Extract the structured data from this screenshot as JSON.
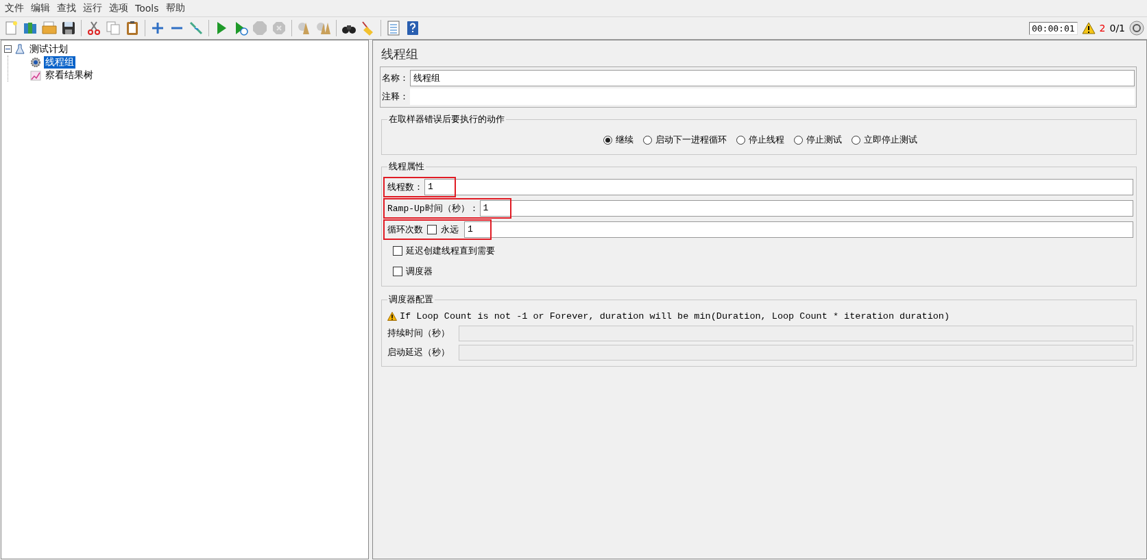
{
  "menu": [
    "文件",
    "编辑",
    "查找",
    "运行",
    "选项",
    "Tools",
    "帮助"
  ],
  "toolbar": {
    "groups": [
      [
        {
          "kind": "new",
          "disabled": false
        },
        {
          "kind": "templates",
          "disabled": false
        },
        {
          "kind": "open",
          "disabled": false
        },
        {
          "kind": "save",
          "disabled": false
        }
      ],
      [
        {
          "kind": "cut",
          "disabled": false
        },
        {
          "kind": "copy",
          "disabled": false
        },
        {
          "kind": "paste",
          "disabled": false
        }
      ],
      [
        {
          "kind": "add",
          "disabled": false
        },
        {
          "kind": "remove",
          "disabled": false
        },
        {
          "kind": "toggle",
          "disabled": false
        }
      ],
      [
        {
          "kind": "start",
          "disabled": false
        },
        {
          "kind": "start-no-pause",
          "disabled": false
        },
        {
          "kind": "stop",
          "disabled": true
        },
        {
          "kind": "shutdown",
          "disabled": true
        }
      ],
      [
        {
          "kind": "clear",
          "disabled": false
        },
        {
          "kind": "clear-all",
          "disabled": false
        }
      ],
      [
        {
          "kind": "search",
          "disabled": false
        },
        {
          "kind": "reset-search",
          "disabled": false
        }
      ],
      [
        {
          "kind": "functions",
          "disabled": false
        },
        {
          "kind": "help",
          "disabled": false
        }
      ]
    ],
    "timer": "00:00:01",
    "warning_count": "2",
    "threads": "0/1"
  },
  "tree": [
    {
      "label": "测试计划",
      "kind": "plan",
      "expanded": true,
      "selected": false,
      "children": [
        {
          "label": "线程组",
          "kind": "thread-group",
          "selected": true
        },
        {
          "label": "察看结果树",
          "kind": "listener",
          "selected": false
        }
      ]
    }
  ],
  "editor": {
    "title": "线程组",
    "name": {
      "label": "名称：",
      "value": "线程组"
    },
    "comment": {
      "label": "注释："
    },
    "error_action": {
      "title": "在取样器错误后要执行的动作",
      "options": [
        {
          "label": "继续",
          "selected": true
        },
        {
          "label": "启动下一进程循环",
          "selected": false
        },
        {
          "label": "停止线程",
          "selected": false
        },
        {
          "label": "停止测试",
          "selected": false
        },
        {
          "label": "立即停止测试",
          "selected": false
        }
      ]
    },
    "thread_properties": {
      "title": "线程属性",
      "fields": [
        {
          "kind": "text",
          "label": "线程数：",
          "value": "1",
          "highlighted": true
        },
        {
          "kind": "text",
          "label": "Ramp-Up时间（秒）：",
          "value": "1",
          "highlighted": true
        },
        {
          "kind": "loop",
          "label": "循环次数",
          "checkbox_label": "永远",
          "checked": false,
          "value": "1",
          "highlighted": true
        },
        {
          "kind": "checkbox",
          "label": "延迟创建线程直到需要",
          "checked": false
        },
        {
          "kind": "checkbox",
          "label": "调度器",
          "checked": false
        }
      ]
    },
    "scheduler": {
      "title": "调度器配置",
      "warning": "If Loop Count is not -1 or Forever, duration will be min(Duration, Loop Count * iteration duration)",
      "fields": [
        {
          "label": "持续时间（秒）",
          "disabled": true
        },
        {
          "label": "启动延迟（秒）",
          "disabled": true
        }
      ]
    }
  }
}
